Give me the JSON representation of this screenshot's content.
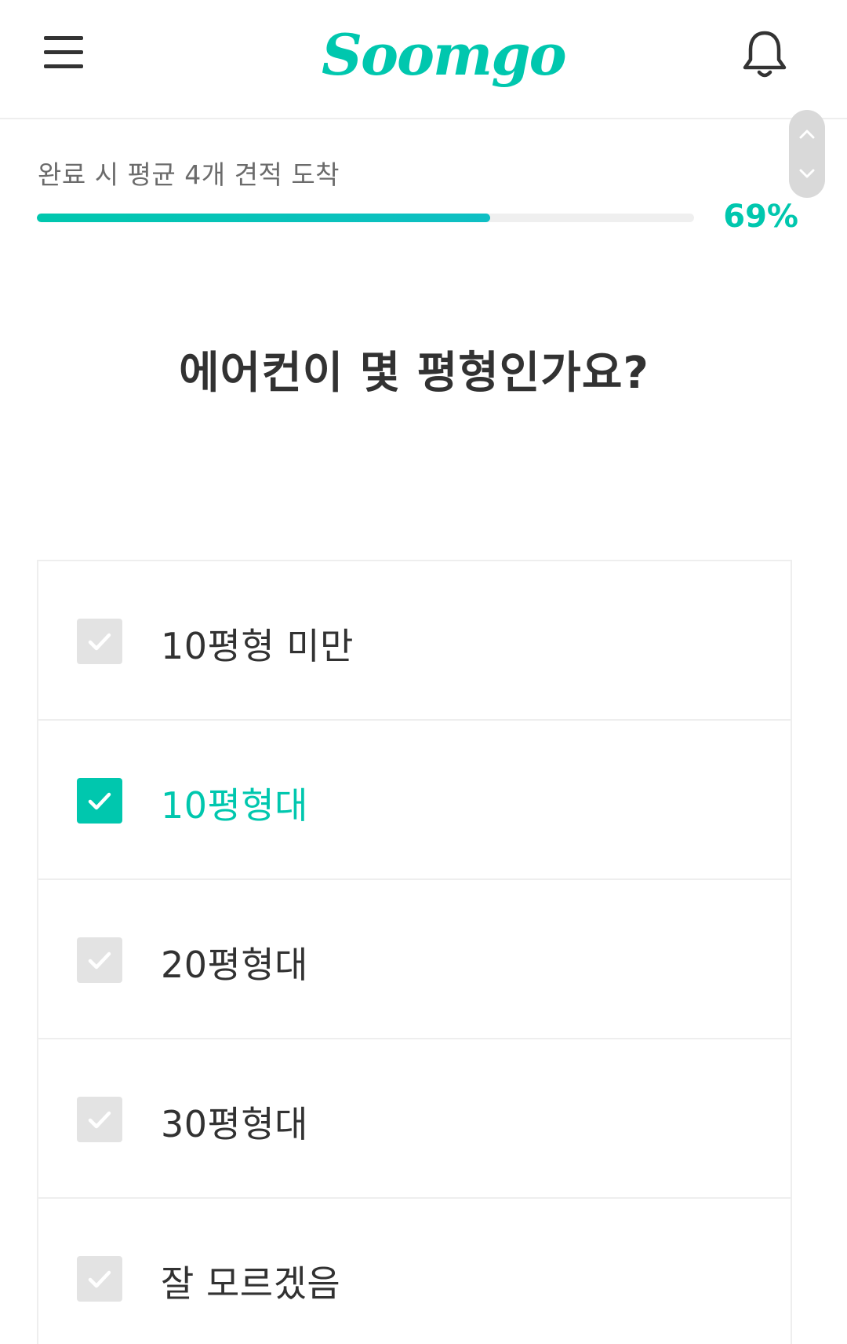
{
  "header": {
    "logo_text": "Soomgo",
    "menu_icon": "hamburger-menu-icon",
    "notification_icon": "bell-icon"
  },
  "progress": {
    "caption": "완료 시 평균 4개 견적 도착",
    "percent_label": "69%",
    "percent_value": 69
  },
  "question": {
    "title": "에어컨이 몇 평형인가요?"
  },
  "options": [
    {
      "label": "10평형 미만",
      "checked": false
    },
    {
      "label": "10평형대",
      "checked": true
    },
    {
      "label": "20평형대",
      "checked": false
    },
    {
      "label": "30평형대",
      "checked": false
    },
    {
      "label": "잘 모르겠음",
      "checked": false
    }
  ],
  "colors": {
    "accent": "#00c7ae",
    "text": "#323232",
    "muted": "#6b6b6b",
    "checkbox_unchecked": "#e3e3e3",
    "border": "#eeeeee"
  }
}
